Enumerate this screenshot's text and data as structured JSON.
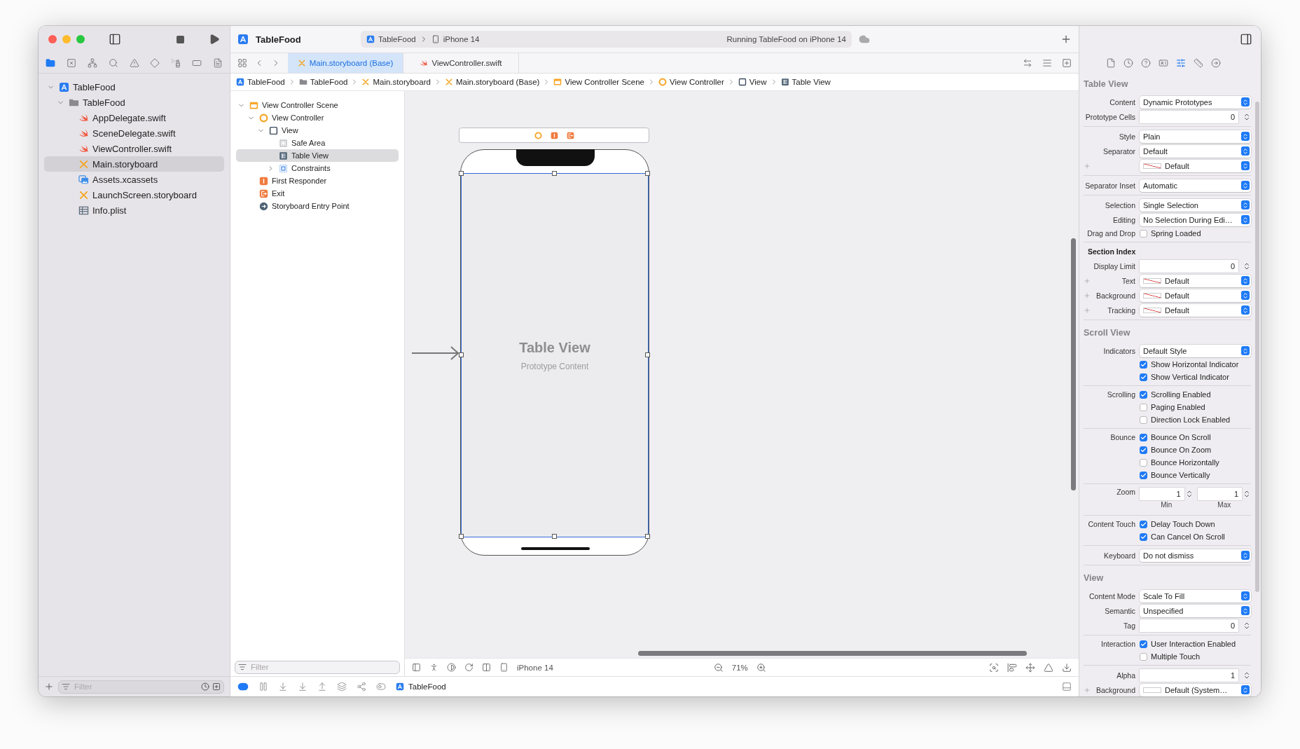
{
  "toolbar": {
    "project": "TableFood",
    "scheme": "TableFood",
    "device": "iPhone 14",
    "status": "Running TableFood on iPhone 14"
  },
  "navigator": {
    "tree": [
      {
        "label": "TableFood",
        "kind": "project",
        "expanded": true,
        "selected": false,
        "children": [
          {
            "label": "TableFood",
            "kind": "folder",
            "expanded": true,
            "selected": false,
            "children": [
              {
                "label": "AppDelegate.swift",
                "kind": "swift",
                "selected": false
              },
              {
                "label": "SceneDelegate.swift",
                "kind": "swift",
                "selected": false
              },
              {
                "label": "ViewController.swift",
                "kind": "swift",
                "selected": false
              },
              {
                "label": "Main.storyboard",
                "kind": "storyboard",
                "selected": true
              },
              {
                "label": "Assets.xcassets",
                "kind": "assets",
                "selected": false
              },
              {
                "label": "LaunchScreen.storyboard",
                "kind": "storyboard",
                "selected": false
              },
              {
                "label": "Info.plist",
                "kind": "plist",
                "selected": false
              }
            ]
          }
        ]
      }
    ],
    "filter": {
      "placeholder": "Filter"
    }
  },
  "tabs": [
    {
      "label": "Main.storyboard (Base)",
      "kind": "storyboard",
      "selected": true
    },
    {
      "label": "ViewController.swift",
      "kind": "swift",
      "selected": false
    }
  ],
  "breadcrumb": [
    {
      "label": "TableFood",
      "kind": "project"
    },
    {
      "label": "TableFood",
      "kind": "folder"
    },
    {
      "label": "Main.storyboard",
      "kind": "storyboard"
    },
    {
      "label": "Main.storyboard (Base)",
      "kind": "storyboard"
    },
    {
      "label": "View Controller Scene",
      "kind": "scene"
    },
    {
      "label": "View Controller",
      "kind": "controller"
    },
    {
      "label": "View",
      "kind": "view"
    },
    {
      "label": "Table View",
      "kind": "table"
    }
  ],
  "outline": {
    "tree": [
      {
        "label": "View Controller Scene",
        "kind": "scene",
        "expanded": true,
        "selected": false,
        "children": [
          {
            "label": "View Controller",
            "kind": "controller",
            "expanded": true,
            "selected": false,
            "children": [
              {
                "label": "View",
                "kind": "view",
                "expanded": true,
                "selected": false,
                "children": [
                  {
                    "label": "Safe Area",
                    "kind": "safearea",
                    "selected": false
                  },
                  {
                    "label": "Table View",
                    "kind": "table",
                    "selected": true
                  },
                  {
                    "label": "Constraints",
                    "kind": "constraints",
                    "expanded": false,
                    "selected": false
                  }
                ]
              }
            ]
          },
          {
            "label": "First Responder",
            "kind": "responder",
            "selected": false
          },
          {
            "label": "Exit",
            "kind": "exit",
            "selected": false
          },
          {
            "label": "Storyboard Entry Point",
            "kind": "entry",
            "selected": false
          }
        ]
      }
    ],
    "filter": {
      "placeholder": "Filter"
    }
  },
  "canvas": {
    "title": "Table View",
    "subtitle": "Prototype Content",
    "device": "iPhone 14",
    "zoom": "71%"
  },
  "debug_bar": {
    "target": "TableFood"
  },
  "inspector": {
    "sections": [
      {
        "title": "Table View",
        "groups": [
          [
            {
              "kind": "popup",
              "label": "Content",
              "value": "Dynamic Prototypes"
            },
            {
              "kind": "stepper",
              "label": "Prototype Cells",
              "value": "0"
            }
          ],
          [
            {
              "kind": "popup",
              "label": "Style",
              "value": "Plain"
            },
            {
              "kind": "popup",
              "label": "Separator",
              "value": "Default"
            },
            {
              "kind": "color",
              "plus": true,
              "slashed": true,
              "value": "Default"
            }
          ],
          [
            {
              "kind": "popup",
              "label": "Separator Inset",
              "value": "Automatic"
            }
          ],
          [
            {
              "kind": "popup",
              "label": "Selection",
              "value": "Single Selection"
            },
            {
              "kind": "popup",
              "label": "Editing",
              "value": "No Selection During Edi…"
            },
            {
              "kind": "checks",
              "label": "Drag and Drop",
              "items": [
                {
                  "label": "Spring Loaded",
                  "checked": false
                }
              ]
            }
          ],
          [
            {
              "kind": "heading",
              "label": "Section Index"
            },
            {
              "kind": "stepper",
              "label": "Display Limit",
              "value": "0"
            },
            {
              "kind": "color",
              "plus": true,
              "slashed": true,
              "label": "Text",
              "value": "Default"
            },
            {
              "kind": "color",
              "plus": true,
              "slashed": true,
              "label": "Background",
              "value": "Default"
            },
            {
              "kind": "color",
              "plus": true,
              "slashed": true,
              "label": "Tracking",
              "value": "Default"
            }
          ]
        ]
      },
      {
        "title": "Scroll View",
        "groups": [
          [
            {
              "kind": "popup",
              "label": "Indicators",
              "value": "Default Style"
            },
            {
              "kind": "checks",
              "items": [
                {
                  "label": "Show Horizontal Indicator",
                  "checked": true
                },
                {
                  "label": "Show Vertical Indicator",
                  "checked": true
                }
              ]
            }
          ],
          [
            {
              "kind": "checks",
              "label": "Scrolling",
              "items": [
                {
                  "label": "Scrolling Enabled",
                  "checked": true
                },
                {
                  "label": "Paging Enabled",
                  "checked": false
                },
                {
                  "label": "Direction Lock Enabled",
                  "checked": false
                }
              ]
            }
          ],
          [
            {
              "kind": "checks",
              "label": "Bounce",
              "items": [
                {
                  "label": "Bounce On Scroll",
                  "checked": true
                },
                {
                  "label": "Bounce On Zoom",
                  "checked": true
                },
                {
                  "label": "Bounce Horizontally",
                  "checked": false
                },
                {
                  "label": "Bounce Vertically",
                  "checked": true
                }
              ]
            }
          ],
          [
            {
              "kind": "zoom",
              "label": "Zoom",
              "min": {
                "value": "1",
                "caption": "Min"
              },
              "max": {
                "value": "1",
                "caption": "Max"
              }
            }
          ],
          [
            {
              "kind": "checks",
              "label": "Content Touch",
              "items": [
                {
                  "label": "Delay Touch Down",
                  "checked": true
                },
                {
                  "label": "Can Cancel On Scroll",
                  "checked": true
                }
              ]
            }
          ],
          [
            {
              "kind": "popup",
              "label": "Keyboard",
              "value": "Do not dismiss"
            }
          ]
        ]
      },
      {
        "title": "View",
        "groups": [
          [
            {
              "kind": "popup",
              "label": "Content Mode",
              "value": "Scale To Fill"
            },
            {
              "kind": "popup",
              "label": "Semantic",
              "value": "Unspecified"
            },
            {
              "kind": "stepper",
              "label": "Tag",
              "value": "0"
            }
          ],
          [
            {
              "kind": "checks",
              "label": "Interaction",
              "items": [
                {
                  "label": "User Interaction Enabled",
                  "checked": true
                },
                {
                  "label": "Multiple Touch",
                  "checked": false
                }
              ]
            }
          ],
          [
            {
              "kind": "stepper",
              "label": "Alpha",
              "value": "1"
            },
            {
              "kind": "color",
              "plus": true,
              "label": "Background",
              "value": "Default (System…",
              "slashed": false
            }
          ]
        ]
      }
    ]
  }
}
